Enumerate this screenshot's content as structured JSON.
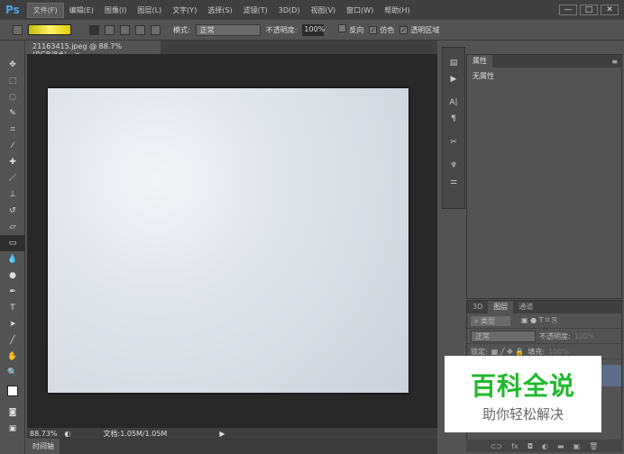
{
  "app": {
    "logo": "Ps"
  },
  "menu": [
    "文件(F)",
    "编辑(E)",
    "图像(I)",
    "图层(L)",
    "文字(Y)",
    "选择(S)",
    "滤镜(T)",
    "3D(D)",
    "视图(V)",
    "窗口(W)",
    "帮助(H)"
  ],
  "window_controls": [
    "—",
    "□",
    "✕"
  ],
  "options": {
    "mode_label": "模式:",
    "mode_value": "正常",
    "opacity_label": "不透明度:",
    "opacity_value": "100%",
    "reverse": "反向",
    "dither": "仿色",
    "transparency": "透明区域"
  },
  "document": {
    "tab": "21163415.jpeg @ 88.7%(RGB/8#)",
    "close": "×"
  },
  "status": {
    "zoom": "88.73%",
    "doc": "文档:1.05M/1.05M"
  },
  "timeline": "时间轴",
  "properties": {
    "tab": "属性",
    "content": "无属性"
  },
  "layers": {
    "tabs": [
      "3D",
      "图层",
      "通道"
    ],
    "filter": "类型",
    "blend": "正常",
    "opacity_label": "不透明度:",
    "opacity_value": "100%",
    "lock_label": "锁定:",
    "fill_label": "填充:",
    "fill_value": "100%"
  },
  "watermark": {
    "title": "百科全说",
    "subtitle": "助你轻松解决"
  }
}
